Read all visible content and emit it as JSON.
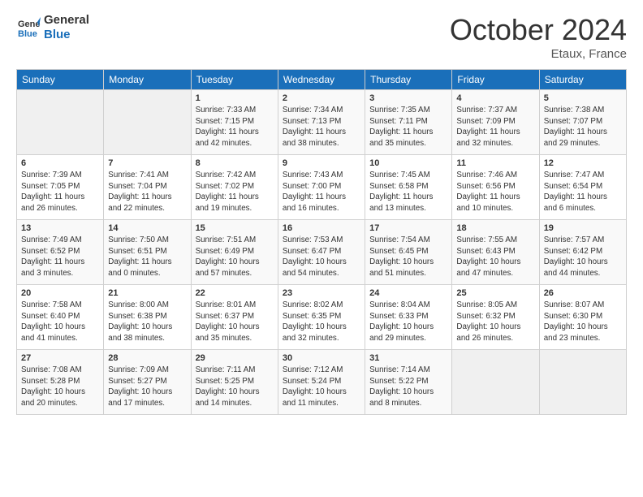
{
  "logo": {
    "line1": "General",
    "line2": "Blue"
  },
  "title": "October 2024",
  "subtitle": "Etaux, France",
  "days_header": [
    "Sunday",
    "Monday",
    "Tuesday",
    "Wednesday",
    "Thursday",
    "Friday",
    "Saturday"
  ],
  "weeks": [
    [
      {
        "day": "",
        "info": ""
      },
      {
        "day": "",
        "info": ""
      },
      {
        "day": "1",
        "info": "Sunrise: 7:33 AM\nSunset: 7:15 PM\nDaylight: 11 hours and 42 minutes."
      },
      {
        "day": "2",
        "info": "Sunrise: 7:34 AM\nSunset: 7:13 PM\nDaylight: 11 hours and 38 minutes."
      },
      {
        "day": "3",
        "info": "Sunrise: 7:35 AM\nSunset: 7:11 PM\nDaylight: 11 hours and 35 minutes."
      },
      {
        "day": "4",
        "info": "Sunrise: 7:37 AM\nSunset: 7:09 PM\nDaylight: 11 hours and 32 minutes."
      },
      {
        "day": "5",
        "info": "Sunrise: 7:38 AM\nSunset: 7:07 PM\nDaylight: 11 hours and 29 minutes."
      }
    ],
    [
      {
        "day": "6",
        "info": "Sunrise: 7:39 AM\nSunset: 7:05 PM\nDaylight: 11 hours and 26 minutes."
      },
      {
        "day": "7",
        "info": "Sunrise: 7:41 AM\nSunset: 7:04 PM\nDaylight: 11 hours and 22 minutes."
      },
      {
        "day": "8",
        "info": "Sunrise: 7:42 AM\nSunset: 7:02 PM\nDaylight: 11 hours and 19 minutes."
      },
      {
        "day": "9",
        "info": "Sunrise: 7:43 AM\nSunset: 7:00 PM\nDaylight: 11 hours and 16 minutes."
      },
      {
        "day": "10",
        "info": "Sunrise: 7:45 AM\nSunset: 6:58 PM\nDaylight: 11 hours and 13 minutes."
      },
      {
        "day": "11",
        "info": "Sunrise: 7:46 AM\nSunset: 6:56 PM\nDaylight: 11 hours and 10 minutes."
      },
      {
        "day": "12",
        "info": "Sunrise: 7:47 AM\nSunset: 6:54 PM\nDaylight: 11 hours and 6 minutes."
      }
    ],
    [
      {
        "day": "13",
        "info": "Sunrise: 7:49 AM\nSunset: 6:52 PM\nDaylight: 11 hours and 3 minutes."
      },
      {
        "day": "14",
        "info": "Sunrise: 7:50 AM\nSunset: 6:51 PM\nDaylight: 11 hours and 0 minutes."
      },
      {
        "day": "15",
        "info": "Sunrise: 7:51 AM\nSunset: 6:49 PM\nDaylight: 10 hours and 57 minutes."
      },
      {
        "day": "16",
        "info": "Sunrise: 7:53 AM\nSunset: 6:47 PM\nDaylight: 10 hours and 54 minutes."
      },
      {
        "day": "17",
        "info": "Sunrise: 7:54 AM\nSunset: 6:45 PM\nDaylight: 10 hours and 51 minutes."
      },
      {
        "day": "18",
        "info": "Sunrise: 7:55 AM\nSunset: 6:43 PM\nDaylight: 10 hours and 47 minutes."
      },
      {
        "day": "19",
        "info": "Sunrise: 7:57 AM\nSunset: 6:42 PM\nDaylight: 10 hours and 44 minutes."
      }
    ],
    [
      {
        "day": "20",
        "info": "Sunrise: 7:58 AM\nSunset: 6:40 PM\nDaylight: 10 hours and 41 minutes."
      },
      {
        "day": "21",
        "info": "Sunrise: 8:00 AM\nSunset: 6:38 PM\nDaylight: 10 hours and 38 minutes."
      },
      {
        "day": "22",
        "info": "Sunrise: 8:01 AM\nSunset: 6:37 PM\nDaylight: 10 hours and 35 minutes."
      },
      {
        "day": "23",
        "info": "Sunrise: 8:02 AM\nSunset: 6:35 PM\nDaylight: 10 hours and 32 minutes."
      },
      {
        "day": "24",
        "info": "Sunrise: 8:04 AM\nSunset: 6:33 PM\nDaylight: 10 hours and 29 minutes."
      },
      {
        "day": "25",
        "info": "Sunrise: 8:05 AM\nSunset: 6:32 PM\nDaylight: 10 hours and 26 minutes."
      },
      {
        "day": "26",
        "info": "Sunrise: 8:07 AM\nSunset: 6:30 PM\nDaylight: 10 hours and 23 minutes."
      }
    ],
    [
      {
        "day": "27",
        "info": "Sunrise: 7:08 AM\nSunset: 5:28 PM\nDaylight: 10 hours and 20 minutes."
      },
      {
        "day": "28",
        "info": "Sunrise: 7:09 AM\nSunset: 5:27 PM\nDaylight: 10 hours and 17 minutes."
      },
      {
        "day": "29",
        "info": "Sunrise: 7:11 AM\nSunset: 5:25 PM\nDaylight: 10 hours and 14 minutes."
      },
      {
        "day": "30",
        "info": "Sunrise: 7:12 AM\nSunset: 5:24 PM\nDaylight: 10 hours and 11 minutes."
      },
      {
        "day": "31",
        "info": "Sunrise: 7:14 AM\nSunset: 5:22 PM\nDaylight: 10 hours and 8 minutes."
      },
      {
        "day": "",
        "info": ""
      },
      {
        "day": "",
        "info": ""
      }
    ]
  ]
}
